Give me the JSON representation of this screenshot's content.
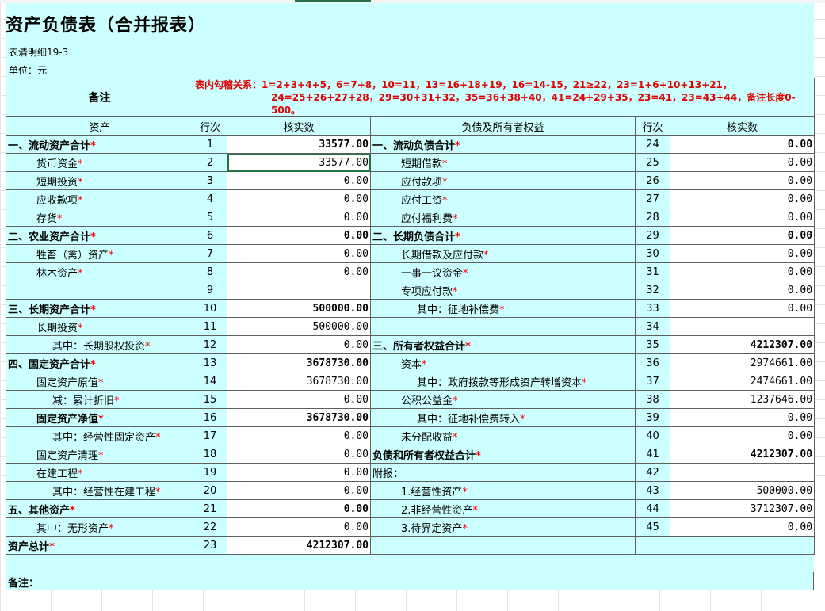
{
  "sheet": {
    "title": "资产负债表（合并报表）",
    "subtitle": "农清明细19-3",
    "unit": "单位：元"
  },
  "note_header": {
    "label": "备注",
    "relation_line1": "表内勾稽关系：1=2+3+4+5，6=7+8，10=11，13=16+18+19，16=14-15，21≥22，23=1+6+10+13+21，",
    "relation_line2": "24=25+26+27+28，29=30+31+32，35=36+38+40，41=24+29+35，23=41，23=43+44，备注长度0-500。"
  },
  "headers": {
    "assets": "资产",
    "row_no": "行次",
    "verified": "核实数",
    "liabilities": "负债及所有者权益",
    "row_no2": "行次",
    "verified2": "核实数"
  },
  "rows": [
    {
      "l": "一、流动资产合计",
      "ls": true,
      "ln": "1",
      "lv": "33577.00",
      "lb": true,
      "li": 1,
      "r": "一、流动负债合计",
      "rs": true,
      "rn": "24",
      "rv": "0.00",
      "rb": true,
      "ri": 1
    },
    {
      "l": "货币资金",
      "ls": true,
      "ln": "2",
      "lv": "33577.00",
      "lb": false,
      "li": 2,
      "r": "短期借款",
      "rs": true,
      "rn": "25",
      "rv": "0.00",
      "rb": false,
      "ri": 2
    },
    {
      "l": "短期投资",
      "ls": true,
      "ln": "3",
      "lv": "0.00",
      "lb": false,
      "li": 2,
      "r": "应付款项",
      "rs": true,
      "rn": "26",
      "rv": "0.00",
      "rb": false,
      "ri": 2
    },
    {
      "l": "应收款项",
      "ls": true,
      "ln": "4",
      "lv": "0.00",
      "lb": false,
      "li": 2,
      "r": "应付工资",
      "rs": true,
      "rn": "27",
      "rv": "0.00",
      "rb": false,
      "ri": 2
    },
    {
      "l": "存货",
      "ls": true,
      "ln": "5",
      "lv": "0.00",
      "lb": false,
      "li": 2,
      "r": "应付福利费",
      "rs": true,
      "rn": "28",
      "rv": "0.00",
      "rb": false,
      "ri": 2
    },
    {
      "l": "二、农业资产合计",
      "ls": true,
      "ln": "6",
      "lv": "0.00",
      "lb": true,
      "li": 1,
      "r": "二、长期负债合计",
      "rs": true,
      "rn": "29",
      "rv": "0.00",
      "rb": true,
      "ri": 1
    },
    {
      "l": "牲畜（禽）资产",
      "ls": true,
      "ln": "7",
      "lv": "0.00",
      "lb": false,
      "li": 2,
      "r": "长期借款及应付款",
      "rs": true,
      "rn": "30",
      "rv": "0.00",
      "rb": false,
      "ri": 2
    },
    {
      "l": "林木资产",
      "ls": true,
      "ln": "8",
      "lv": "0.00",
      "lb": false,
      "li": 2,
      "r": "一事一议资金",
      "rs": true,
      "rn": "31",
      "rv": "0.00",
      "rb": false,
      "ri": 2
    },
    {
      "l": "",
      "ls": false,
      "ln": "9",
      "lv": "",
      "lb": false,
      "li": 2,
      "r": "专项应付款",
      "rs": true,
      "rn": "32",
      "rv": "0.00",
      "rb": false,
      "ri": 2
    },
    {
      "l": "三、长期资产合计",
      "ls": true,
      "ln": "10",
      "lv": "500000.00",
      "lb": true,
      "li": 1,
      "r": "其中：征地补偿费",
      "rs": true,
      "rn": "33",
      "rv": "0.00",
      "rb": false,
      "ri": 3
    },
    {
      "l": "长期投资",
      "ls": true,
      "ln": "11",
      "lv": "500000.00",
      "lb": false,
      "li": 2,
      "r": "",
      "rs": false,
      "rn": "34",
      "rv": "",
      "rb": false,
      "ri": 2
    },
    {
      "l": "其中：长期股权投资",
      "ls": true,
      "ln": "12",
      "lv": "0.00",
      "lb": false,
      "li": 3,
      "r": "三、所有者权益合计",
      "rs": true,
      "rn": "35",
      "rv": "4212307.00",
      "rb": true,
      "ri": 1
    },
    {
      "l": "四、固定资产合计",
      "ls": true,
      "ln": "13",
      "lv": "3678730.00",
      "lb": true,
      "li": 1,
      "r": "资本",
      "rs": true,
      "rn": "36",
      "rv": "2974661.00",
      "rb": false,
      "ri": 2
    },
    {
      "l": "固定资产原值",
      "ls": true,
      "ln": "14",
      "lv": "3678730.00",
      "lb": false,
      "li": 2,
      "r": "其中：政府拨款等形成资产转增资本",
      "rs": true,
      "rn": "37",
      "rv": "2474661.00",
      "rb": false,
      "ri": 3
    },
    {
      "l": "减：累计折旧",
      "ls": true,
      "ln": "15",
      "lv": "0.00",
      "lb": false,
      "li": 3,
      "r": "公积公益金",
      "rs": true,
      "rn": "38",
      "rv": "1237646.00",
      "rb": false,
      "ri": 2
    },
    {
      "l": "固定资产净值",
      "ls": true,
      "ln": "16",
      "lv": "3678730.00",
      "lb": true,
      "li": 2,
      "r": "其中：征地补偿费转入",
      "rs": true,
      "rn": "39",
      "rv": "0.00",
      "rb": false,
      "ri": 3
    },
    {
      "l": "其中：经营性固定资产",
      "ls": true,
      "ln": "17",
      "lv": "0.00",
      "lb": false,
      "li": 3,
      "r": "未分配收益",
      "rs": true,
      "rn": "40",
      "rv": "0.00",
      "rb": false,
      "ri": 2
    },
    {
      "l": "固定资产清理",
      "ls": true,
      "ln": "18",
      "lv": "0.00",
      "lb": false,
      "li": 2,
      "r": "负债和所有者权益合计",
      "rs": true,
      "rn": "41",
      "rv": "4212307.00",
      "rb": true,
      "ri": 0
    },
    {
      "l": "在建工程",
      "ls": true,
      "ln": "19",
      "lv": "0.00",
      "lb": false,
      "li": 2,
      "r": "附报：",
      "rs": false,
      "rn": "42",
      "rv": "",
      "rb": false,
      "ri": 0
    },
    {
      "l": "其中：经营性在建工程",
      "ls": true,
      "ln": "20",
      "lv": "0.00",
      "lb": false,
      "li": 3,
      "r": "1.经营性资产",
      "rs": true,
      "rn": "43",
      "rv": "500000.00",
      "rb": false,
      "ri": 2
    },
    {
      "l": "五、其他资产",
      "ls": true,
      "ln": "21",
      "lv": "0.00",
      "lb": true,
      "li": 1,
      "r": "2.非经营性资产",
      "rs": true,
      "rn": "44",
      "rv": "3712307.00",
      "rb": false,
      "ri": 2
    },
    {
      "l": "其中：无形资产",
      "ls": true,
      "ln": "22",
      "lv": "0.00",
      "lb": false,
      "li": 2,
      "r": "3.待界定资产",
      "rs": true,
      "rn": "45",
      "rv": "0.00",
      "rb": false,
      "ri": 2
    },
    {
      "l": "资产总计",
      "ls": true,
      "ln": "23",
      "lv": "4212307.00",
      "lb": true,
      "li": 0,
      "r": "",
      "rs": false,
      "rn": "",
      "rv": "",
      "rb": false,
      "ri": 0
    }
  ],
  "footer": {
    "label": "备注："
  },
  "colors": {
    "sheet_bg": "#ccffff",
    "required_star": "#ff0000",
    "relation_text": "#e00000",
    "selection": "#217346"
  }
}
